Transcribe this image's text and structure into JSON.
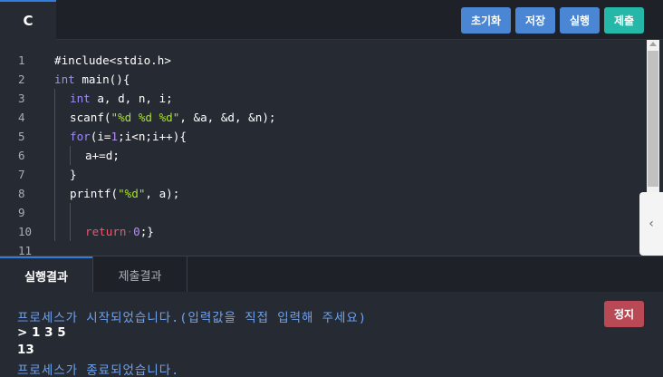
{
  "language_tab": "C",
  "toolbar": {
    "reset_label": "초기화",
    "save_label": "저장",
    "run_label": "실행",
    "submit_label": "제출"
  },
  "editor": {
    "line_numbers": [
      "1",
      "2",
      "3",
      "4",
      "5",
      "6",
      "7",
      "8",
      "9",
      "10",
      "11"
    ],
    "lines": {
      "l1": "#include<stdio.h>",
      "l2_kw": "int",
      "l2_rest": " main(){",
      "l3_kw": "int",
      "l3_rest": " a, d, n, i;",
      "l4_a": "scanf(",
      "l4_str": "\"%d %d %d\"",
      "l4_b": ", &a, &d, &n);",
      "l5_kw": "for",
      "l5_a": "(i=",
      "l5_num": "1",
      "l5_b": ";i<n;i++){",
      "l6": "a+=d;",
      "l7": "}",
      "l8_a": "printf(",
      "l8_str": "\"%d\"",
      "l8_b": ", a);",
      "l10_kw": "return",
      "l10_dot": "·",
      "l10_num": "0",
      "l10_b": ";}"
    },
    "collapse_glyph": "‹"
  },
  "result": {
    "tab_run_result": "실행결과",
    "tab_submit_result": "제출결과",
    "stop_label": "정지",
    "console": {
      "line1": "프로세스가 시작되었습니다.(입력값을 직접 입력해 주세요)",
      "line2": "> 1 3 5",
      "line3": "13",
      "line4": "프로세스가 종료되었습니다."
    }
  },
  "colors": {
    "accent": "#2f7de1",
    "keyword": "#9b8cf3",
    "return_keyword": "#f2546b",
    "string": "#a6e22e",
    "number": "#b48cf2",
    "system_text": "#6ea3f0",
    "submit_button": "#25b7a7",
    "stop_button": "#b94a55"
  }
}
